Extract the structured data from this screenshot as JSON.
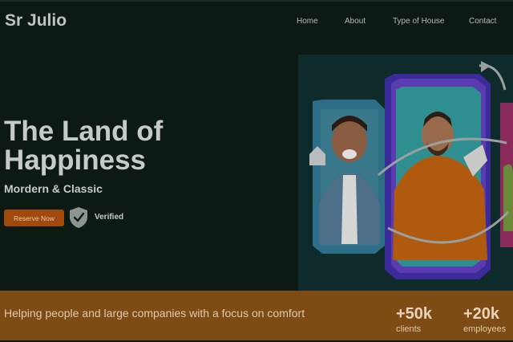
{
  "brand": "Sr Julio",
  "nav": [
    "Home",
    "About",
    "Type of House",
    "Contact"
  ],
  "hero": {
    "title_line1": "The Land of",
    "title_line2": "Happiness",
    "subtitle": "Mordern & Classic",
    "cta_label": "Reserve Now",
    "verified_label": "Verified"
  },
  "footer": {
    "tagline": "Helping people and large companies with a focus on comfort",
    "stats": [
      {
        "value": "+50k",
        "label": "clients"
      },
      {
        "value": "+20k",
        "label": "employees"
      }
    ]
  },
  "colors": {
    "accent": "#a04b0c",
    "bar": "#7d4b14",
    "background": "#0d1a14"
  }
}
